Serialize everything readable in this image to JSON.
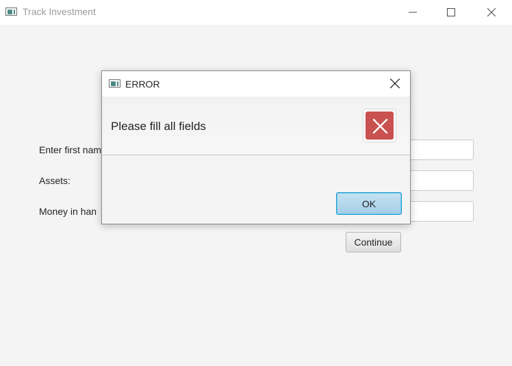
{
  "window": {
    "title": "Track Investment",
    "icon": "app-window-icon",
    "controls": [
      "minimize-icon",
      "maximize-icon",
      "close-icon"
    ]
  },
  "form": {
    "first_name_label": "Enter first nam",
    "assets_label": "Assets:",
    "money_label": "Money in han",
    "first_name_value": "",
    "assets_value": "",
    "money_value": "",
    "continue_label": "Continue"
  },
  "dialog": {
    "title": "ERROR",
    "message": "Please fill all fields",
    "ok_label": "OK",
    "icon": "error-icon",
    "colors": {
      "error": "#c9514f",
      "ok_border": "#0f9ad6"
    }
  }
}
